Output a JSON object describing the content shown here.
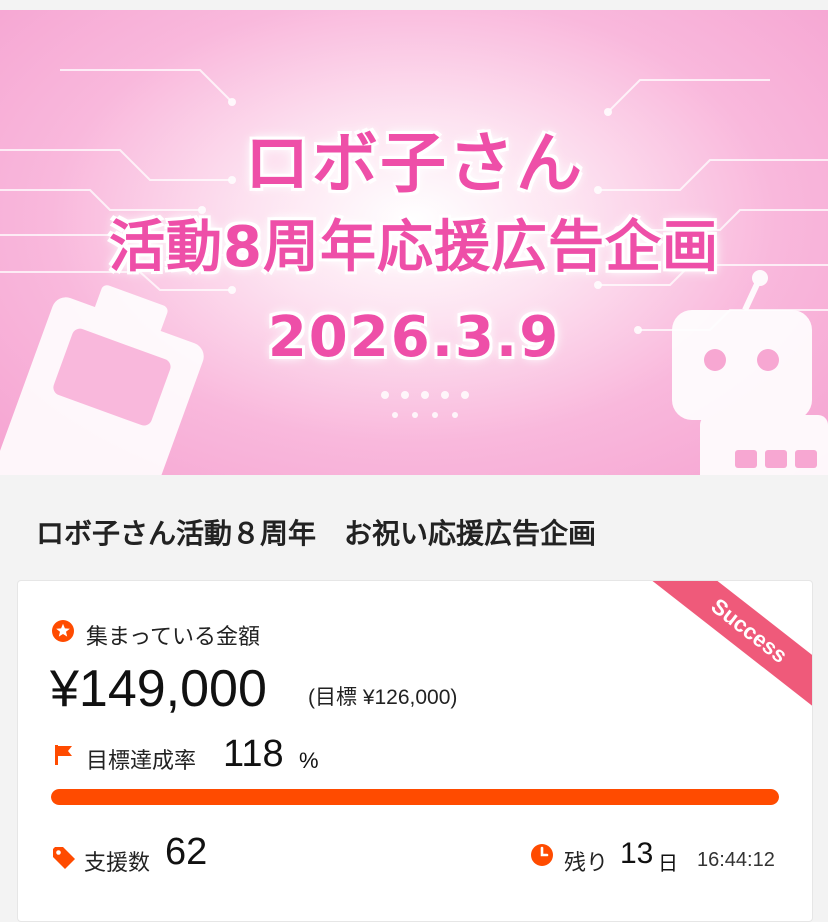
{
  "banner": {
    "line1": "ロボ子さん",
    "line2": "活動8周年応援広告企画",
    "date": "2026.3.9"
  },
  "project": {
    "title": "ロボ子さん活動８周年　お祝い応援広告企画"
  },
  "stats": {
    "badge": "Success",
    "collected_label": "集まっている金額",
    "collected_amount": "¥149,000",
    "goal_text": "(目標 ¥126,000)",
    "achievement_label": "目標達成率",
    "achievement_value": "118",
    "achievement_unit": "%",
    "progress_fraction": 1.0,
    "supporters_label": "支援数",
    "supporters_value": "62",
    "remaining_label": "残り",
    "remaining_days": "13",
    "remaining_days_unit": "日",
    "remaining_time": "16:44:12"
  },
  "icons": {
    "collected": "star-icon",
    "achievement": "flag-icon",
    "supporters": "tag-icon",
    "remaining": "clock-icon"
  },
  "colors": {
    "accent": "#ff4b00",
    "badge": "#ef5a7a",
    "banner_text": "#ee4fa8"
  }
}
